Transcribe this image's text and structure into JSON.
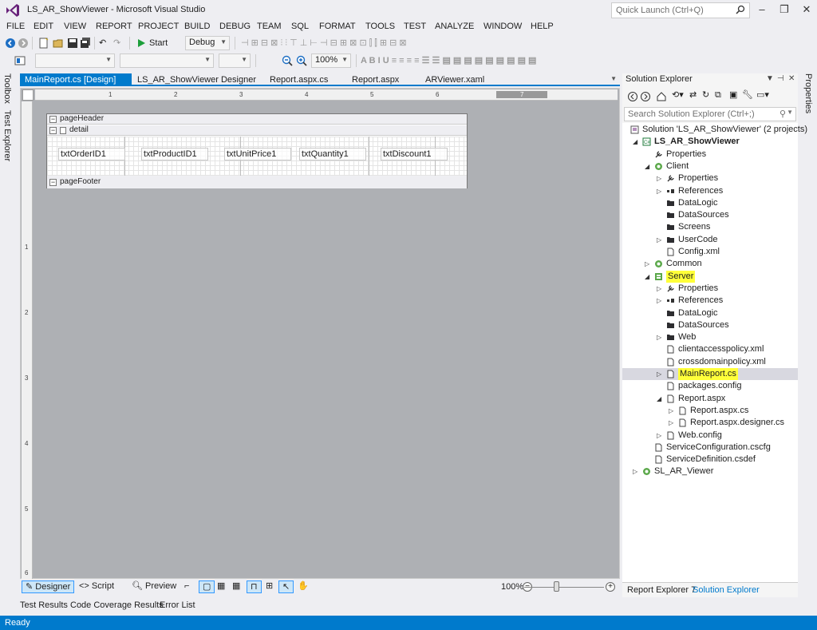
{
  "window": {
    "title": "LS_AR_ShowViewer - Microsoft Visual Studio",
    "quick_launch_placeholder": "Quick Launch (Ctrl+Q)",
    "min": "–",
    "max": "❐",
    "close": "✕"
  },
  "menu": [
    "FILE",
    "EDIT",
    "VIEW",
    "REPORT",
    "PROJECT",
    "BUILD",
    "DEBUG",
    "TEAM",
    "SQL",
    "FORMAT",
    "TOOLS",
    "TEST",
    "ANALYZE",
    "WINDOW",
    "HELP"
  ],
  "toolbar": {
    "start_label": "Start",
    "config_value": "Debug",
    "zoom_value": "100%"
  },
  "left_tabs": [
    "Toolbox",
    "Test Explorer"
  ],
  "right_tab": "Properties",
  "doc_tabs": [
    "MainReport.cs [Design]",
    "LS_AR_ShowViewer Designer",
    "Report.aspx.cs",
    "Report.aspx",
    "ARViewer.xaml"
  ],
  "ruler": {
    "h": [
      "1",
      "2",
      "3",
      "4",
      "5",
      "6",
      "7"
    ],
    "v": [
      "1",
      "2",
      "3",
      "4",
      "5",
      "6"
    ]
  },
  "report": {
    "bands": {
      "header": "pageHeader",
      "detail": "detail",
      "footer": "pageFooter"
    },
    "fields": [
      "txtOrderID1",
      "txtProductID1",
      "txtUnitPrice1",
      "txtQuantity1",
      "txtDiscount1"
    ]
  },
  "designer_bar": {
    "designer": "Designer",
    "script": "Script",
    "preview": "Preview",
    "zoom": "100%"
  },
  "bottom_tabs": [
    "Test Results",
    "Code Coverage Results",
    "Error List"
  ],
  "status": "Ready",
  "solution_explorer": {
    "title": "Solution Explorer",
    "search_placeholder": "Search Solution Explorer (Ctrl+;)",
    "tree": [
      {
        "label": "Solution 'LS_AR_ShowViewer' (2 projects)",
        "arrow": "",
        "icon": "solution-icon"
      },
      {
        "label": "LS_AR_ShowViewer",
        "arrow": "◢",
        "icon": "csharp-project-icon"
      },
      {
        "label": "Properties",
        "arrow": "",
        "icon": "wrench-icon"
      },
      {
        "label": "Client",
        "arrow": "◢",
        "icon": "lightswitch-icon"
      },
      {
        "label": "Properties",
        "arrow": "▷",
        "icon": "wrench-icon"
      },
      {
        "label": "References",
        "arrow": "▷",
        "icon": "references-icon"
      },
      {
        "label": "DataLogic",
        "arrow": "",
        "icon": "folder-icon"
      },
      {
        "label": "DataSources",
        "arrow": "",
        "icon": "folder-icon"
      },
      {
        "label": "Screens",
        "arrow": "",
        "icon": "folder-icon"
      },
      {
        "label": "UserCode",
        "arrow": "▷",
        "icon": "folder-icon"
      },
      {
        "label": "Config.xml",
        "arrow": "",
        "icon": "file-icon"
      },
      {
        "label": "Common",
        "arrow": "▷",
        "icon": "lightswitch-icon"
      },
      {
        "label": "Server",
        "arrow": "◢",
        "icon": "server-project-icon"
      },
      {
        "label": "Properties",
        "arrow": "▷",
        "icon": "wrench-icon"
      },
      {
        "label": "References",
        "arrow": "▷",
        "icon": "references-icon"
      },
      {
        "label": "DataLogic",
        "arrow": "",
        "icon": "folder-icon"
      },
      {
        "label": "DataSources",
        "arrow": "",
        "icon": "folder-icon"
      },
      {
        "label": "Web",
        "arrow": "▷",
        "icon": "folder-icon"
      },
      {
        "label": "clientaccesspolicy.xml",
        "arrow": "",
        "icon": "file-icon"
      },
      {
        "label": "crossdomainpolicy.xml",
        "arrow": "",
        "icon": "file-icon"
      },
      {
        "label": "MainReport.cs",
        "arrow": "▷",
        "icon": "file-icon"
      },
      {
        "label": "packages.config",
        "arrow": "",
        "icon": "file-icon"
      },
      {
        "label": "Report.aspx",
        "arrow": "◢",
        "icon": "file-icon"
      },
      {
        "label": "Report.aspx.cs",
        "arrow": "▷",
        "icon": "file-icon"
      },
      {
        "label": "Report.aspx.designer.cs",
        "arrow": "▷",
        "icon": "file-icon"
      },
      {
        "label": "Web.config",
        "arrow": "▷",
        "icon": "file-icon"
      },
      {
        "label": "ServiceConfiguration.cscfg",
        "arrow": "",
        "icon": "file-icon"
      },
      {
        "label": "ServiceDefinition.csdef",
        "arrow": "",
        "icon": "file-icon"
      },
      {
        "label": "SL_AR_Viewer",
        "arrow": "▷",
        "icon": "lightswitch-icon"
      }
    ],
    "bottom_tabs": [
      "Report Explorer 7",
      "Solution Explorer"
    ]
  },
  "colors": {
    "accent": "#007acc",
    "highlight": "#ffff3a"
  }
}
